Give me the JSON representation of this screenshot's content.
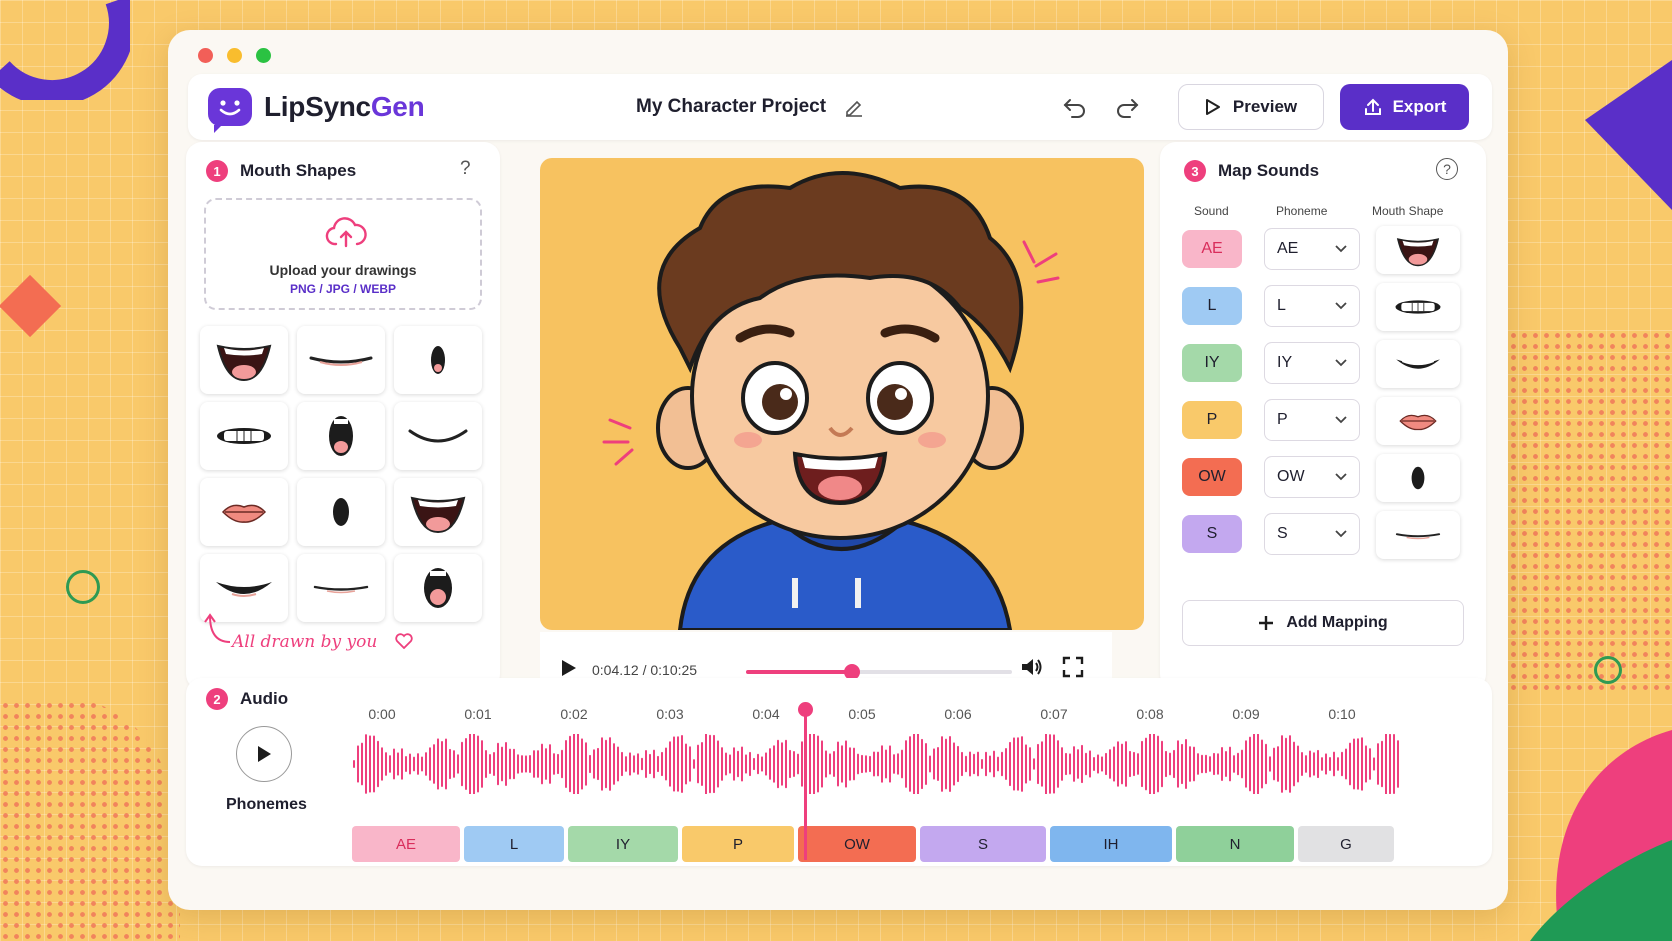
{
  "app": {
    "name_part1": "LipSync",
    "name_part2": "Gen",
    "project_title": "My Character Project"
  },
  "toolbar": {
    "preview_label": "Preview",
    "export_label": "Export"
  },
  "mouth_shapes": {
    "step": "1",
    "title": "Mouth Shapes",
    "help": "?",
    "upload_title": "Upload your drawings",
    "upload_formats": "PNG / JPG / WEBP",
    "annotation": "All drawn by you"
  },
  "player": {
    "time": "0:04.12 / 0:10:25",
    "progress": 0.4
  },
  "map_sounds": {
    "step": "3",
    "title": "Map Sounds",
    "help": "?",
    "columns": [
      "Sound",
      "Phoneme",
      "Mouth Shape"
    ],
    "rows": [
      {
        "sound": "AE",
        "phoneme": "AE",
        "color": "#f9b6c9",
        "text_color": "#d92d5b"
      },
      {
        "sound": "L",
        "phoneme": "L",
        "color": "#9fcaf3",
        "text_color": "#1f1f2e"
      },
      {
        "sound": "IY",
        "phoneme": "IY",
        "color": "#a4d9a9",
        "text_color": "#1f1f2e"
      },
      {
        "sound": "P",
        "phoneme": "P",
        "color": "#f9c96a",
        "text_color": "#1f1f2e"
      },
      {
        "sound": "OW",
        "phoneme": "OW",
        "color": "#f36d52",
        "text_color": "#1f1f2e"
      },
      {
        "sound": "S",
        "phoneme": "S",
        "color": "#c3a8ef",
        "text_color": "#1f1f2e"
      }
    ],
    "add_label": "Add Mapping"
  },
  "audio": {
    "step": "2",
    "title": "Audio",
    "phonemes_label": "Phonemes",
    "ticks": [
      "0:00",
      "0:01",
      "0:02",
      "0:03",
      "0:04",
      "0:05",
      "0:06",
      "0:07",
      "0:08",
      "0:09",
      "0:10"
    ],
    "phonemes": [
      {
        "label": "AE",
        "color": "#f9b6c9",
        "text_color": "#d92d5b"
      },
      {
        "label": "L",
        "color": "#9fcaf3",
        "text_color": "#1f1f2e"
      },
      {
        "label": "IY",
        "color": "#a4d9a9",
        "text_color": "#1f1f2e"
      },
      {
        "label": "P",
        "color": "#f9c96a",
        "text_color": "#1f1f2e"
      },
      {
        "label": "OW",
        "color": "#f36d52",
        "text_color": "#1f1f2e"
      },
      {
        "label": "S",
        "color": "#c3a8ef",
        "text_color": "#1f1f2e"
      },
      {
        "label": "IH",
        "color": "#7fb6ee",
        "text_color": "#1f1f2e"
      },
      {
        "label": "N",
        "color": "#8fd09a",
        "text_color": "#1f1f2e"
      },
      {
        "label": "G",
        "color": "#e1e1e3",
        "text_color": "#1f1f2e"
      }
    ]
  },
  "colors": {
    "brand_purple": "#5a2fc8",
    "accent_pink": "#ee3f7d"
  }
}
